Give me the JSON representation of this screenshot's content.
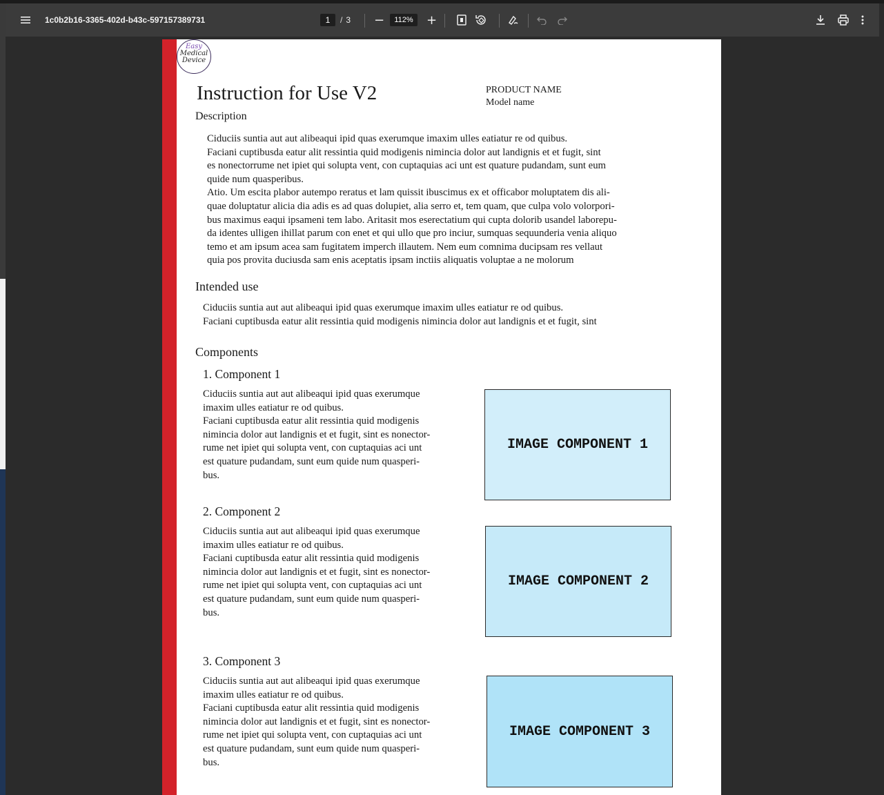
{
  "toolbar": {
    "doc_title": "1c0b2b16-3365-402d-b43c-597157389731",
    "current_page": "1",
    "page_separator": "/",
    "total_pages": "3",
    "zoom_minus": "−",
    "zoom": "112%",
    "zoom_plus": "+",
    "icons": [
      "menu-icon",
      "fit-page-icon",
      "rotate-icon",
      "annotate-icon",
      "undo-icon",
      "redo-icon",
      "download-icon",
      "print-icon",
      "more-options-icon"
    ]
  },
  "document": {
    "logo": {
      "line1": "Easy",
      "line2": "Medical",
      "line3": "Device"
    },
    "title": "Instruction for Use V2",
    "product_name": "PRODUCT NAME",
    "model_name": "Model name",
    "description_heading": "Description",
    "description_lines": [
      "Ciduciis suntia aut aut alibeaqui ipid quas exerumque imaxim ulles eatiatur re od quibus.",
      "Faciani cuptibusda eatur alit ressintia quid modigenis nimincia dolor aut landignis et et fugit, sint",
      "es nonectorrume net ipiet qui solupta vent, con cuptaquias aci unt est quature pudandam, sunt eum",
      "quide num quasperibus.",
      "Atio. Um escita plabor autempo reratus et lam quissit ibuscimus ex et officabor moluptatem dis ali-",
      "quae doluptatur alicia dia adis es ad quas dolupiet, alia serro et, tem quam, que culpa volo volorpori-",
      "bus maximus eaqui ipsameni tem labo. Aritasit mos eserectatium qui cupta dolorib usandel laborepu-",
      "da identes ulligen ihillat parum con enet et qui ullo que pro inciur, sumquas sequunderia venia aliquo",
      "temo et am ipsum acea sam fugitatem imperch illautem. Nem eum comnima ducipsam res vellaut",
      "quia pos provita duciusda sam enis aceptatis ipsam inctiis aliquatis voluptae a ne molorum"
    ],
    "intended_heading": "Intended use",
    "intended_lines": [
      "Ciduciis suntia aut aut alibeaqui ipid quas exerumque imaxim ulles eatiatur re od quibus.",
      "Faciani cuptibusda eatur alit ressintia quid modigenis nimincia dolor aut landignis et et fugit, sint"
    ],
    "components_heading": "Components",
    "components": [
      {
        "title": "1. Component 1",
        "lines": [
          "Ciduciis suntia aut aut alibeaqui ipid quas exerumque",
          "imaxim ulles eatiatur re od quibus.",
          "Faciani cuptibusda eatur alit ressintia quid modigenis",
          "nimincia dolor aut landignis et et fugit, sint es nonector-",
          "rume net ipiet qui solupta vent, con cuptaquias aci unt",
          "est quature pudandam, sunt eum quide num quasperi-",
          "bus."
        ],
        "image_label": "IMAGE COMPONENT 1",
        "image_color": "#d2eefa"
      },
      {
        "title": "2. Component 2",
        "lines": [
          "Ciduciis suntia aut aut alibeaqui ipid quas exerumque",
          "imaxim ulles eatiatur re od quibus.",
          "Faciani cuptibusda eatur alit ressintia quid modigenis",
          "nimincia dolor aut landignis et et fugit, sint es nonector-",
          "rume net ipiet qui solupta vent, con cuptaquias aci unt",
          "est quature pudandam, sunt eum quide num quasperi-",
          "bus."
        ],
        "image_label": "IMAGE COMPONENT 2",
        "image_color": "#c6eaf9"
      },
      {
        "title": "3. Component 3",
        "lines": [
          "Ciduciis suntia aut aut alibeaqui ipid quas exerumque",
          "imaxim ulles eatiatur re od quibus.",
          "Faciani cuptibusda eatur alit ressintia quid modigenis",
          "nimincia dolor aut landignis et et fugit, sint es nonector-",
          "rume net ipiet qui solupta vent, con cuptaquias aci unt",
          "est quature pudandam, sunt eum quide num quasperi-",
          "bus."
        ],
        "image_label": "IMAGE COMPONENT 3",
        "image_color": "#b0e3f8"
      }
    ],
    "accent_color": "#d3222a"
  }
}
